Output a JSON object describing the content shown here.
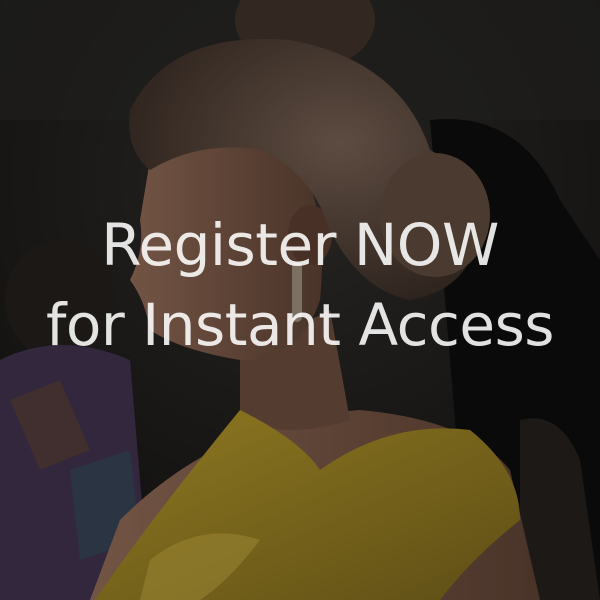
{
  "photo": {
    "subject": "woman-in-yellow-dress-profile",
    "colors": {
      "background": "#1e1e1e",
      "dress": "#b89a2a",
      "skin": "#8a6450",
      "hair": "#5c4636",
      "overlay": "rgba(0,0,0,0.32)"
    }
  },
  "cta": {
    "line1": "Register NOW",
    "line2": "for Instant Access"
  }
}
